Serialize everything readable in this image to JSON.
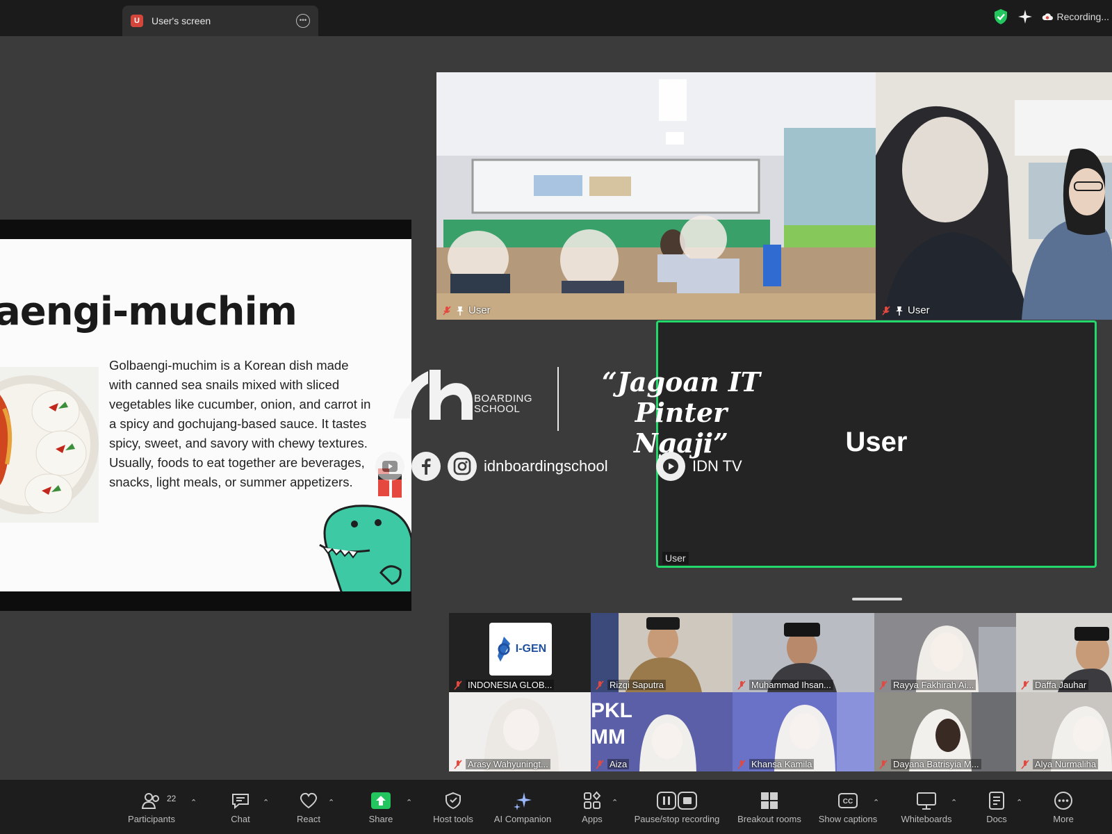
{
  "topbar": {
    "share_badge": "U",
    "share_title": "User's screen",
    "recording_label": "Recording..."
  },
  "slide": {
    "title": "aengi-muchim",
    "body": "Golbaengi-muchim is a Korean dish made with canned sea snails mixed with sliced vegetables like cucumber, onion, and carrot in a spicy and gochujang-based sauce. It tastes spicy, sweet, and savory with chewy textures. Usually, foods to eat together are beverages, snacks, light meals, or summer appetizers."
  },
  "videos": {
    "cam1_name": "User",
    "cam2_name": "User"
  },
  "speaker": {
    "name": "User",
    "label": "User"
  },
  "watermark": {
    "boarding_line1": "BOARDING",
    "boarding_line2": "SCHOOL",
    "tagline_line1": "“Jagoan IT",
    "tagline_line2": "Pinter Ngaji”",
    "instagram_handle": "idnboardingschool",
    "youtube_channel": "IDN TV"
  },
  "gallery": [
    {
      "name": "INDONESIA GLOB..."
    },
    {
      "name": "Rizqi Saputra"
    },
    {
      "name": "Muhammad Ihsan..."
    },
    {
      "name": "Rayya Fakhirah Ai..."
    },
    {
      "name": "Daffa Jauhar"
    },
    {
      "name": "Arasy Wahyuningt..."
    },
    {
      "name": "Aiza"
    },
    {
      "name": "Khansa Kamila"
    },
    {
      "name": "Dayana Batrisyia M..."
    },
    {
      "name": "Alya Nurmaliha"
    }
  ],
  "gallery_extra": {
    "igen_logo_text": "I-GEN",
    "pkl_text": "PKL MM"
  },
  "toolbar": {
    "participants_count": "22",
    "items": [
      {
        "label": "Participants",
        "icon": "participants-icon"
      },
      {
        "label": "Chat",
        "icon": "chat-icon"
      },
      {
        "label": "React",
        "icon": "heart-icon"
      },
      {
        "label": "Share",
        "icon": "share-icon"
      },
      {
        "label": "Host tools",
        "icon": "shield-icon"
      },
      {
        "label": "AI Companion",
        "icon": "sparkle-icon"
      },
      {
        "label": "Apps",
        "icon": "apps-icon"
      },
      {
        "label": "Pause/stop recording",
        "icon": "recording-controls-icon"
      },
      {
        "label": "Breakout rooms",
        "icon": "breakout-rooms-icon"
      },
      {
        "label": "Show captions",
        "icon": "captions-icon"
      },
      {
        "label": "Whiteboards",
        "icon": "whiteboard-icon"
      },
      {
        "label": "Docs",
        "icon": "docs-icon"
      },
      {
        "label": "More",
        "icon": "more-icon"
      }
    ]
  },
  "colors": {
    "active_speaker_border": "#23d96b",
    "share_green": "#23c55e",
    "mic_off_red": "#e5483f"
  }
}
